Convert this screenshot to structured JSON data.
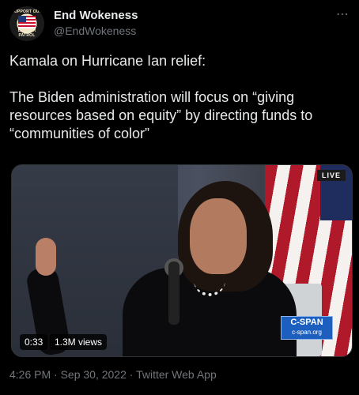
{
  "author": {
    "name": "End Wokeness",
    "handle": "@EndWokeness",
    "avatar_text_top": "SUPPORT OUR",
    "avatar_text_bottom": "BORDER PATROL",
    "more_icon": "⋯"
  },
  "tweet": {
    "text": "Kamala on Hurricane Ian relief:\n\nThe Biden administration will focus on “giving resources based on equity” by directing funds to “communities of color”"
  },
  "media": {
    "live_label": "LIVE",
    "network_name": "C-SPAN",
    "network_url": "c-span.org",
    "duration": "0:33",
    "views": "1.3M views"
  },
  "meta": {
    "timestamp": "4:26 PM · Sep 30, 2022 · Twitter Web App"
  },
  "colors": {
    "background": "#000000",
    "text": "#e7e9ea",
    "secondary": "#71767b",
    "cspan_blue": "#1c5fbf"
  }
}
